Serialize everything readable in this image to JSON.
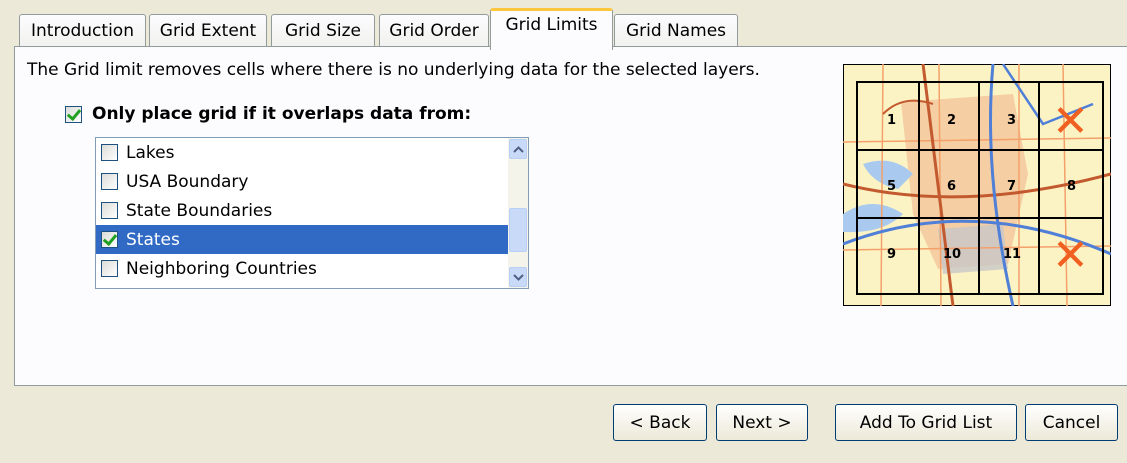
{
  "tabs": [
    {
      "label": "Introduction"
    },
    {
      "label": "Grid Extent"
    },
    {
      "label": "Grid Size"
    },
    {
      "label": "Grid Order"
    },
    {
      "label": "Grid Limits"
    },
    {
      "label": "Grid Names"
    }
  ],
  "active_tab": "Grid Limits",
  "description": "The Grid limit removes cells where there is no underlying data for the selected layers.",
  "overlap_check": {
    "label": "Only place grid if it overlaps data from:",
    "checked": true
  },
  "layers": [
    {
      "label": "Lakes",
      "checked": false,
      "selected": false
    },
    {
      "label": "USA Boundary",
      "checked": false,
      "selected": false
    },
    {
      "label": "State Boundaries",
      "checked": false,
      "selected": false
    },
    {
      "label": "States",
      "checked": true,
      "selected": true
    },
    {
      "label": "Neighboring Countries",
      "checked": false,
      "selected": false
    }
  ],
  "preview": {
    "cell_numbers": [
      "1",
      "2",
      "3",
      "5",
      "6",
      "7",
      "8",
      "9",
      "10",
      "11"
    ],
    "removed_marker": "✕"
  },
  "buttons": {
    "back": "< Back",
    "next": "Next >",
    "add": "Add To Grid List",
    "cancel": "Cancel"
  },
  "colors": {
    "selection": "#316ac5",
    "active_tab_accent": "#ffc83c",
    "removed_marker": "#f06020"
  }
}
